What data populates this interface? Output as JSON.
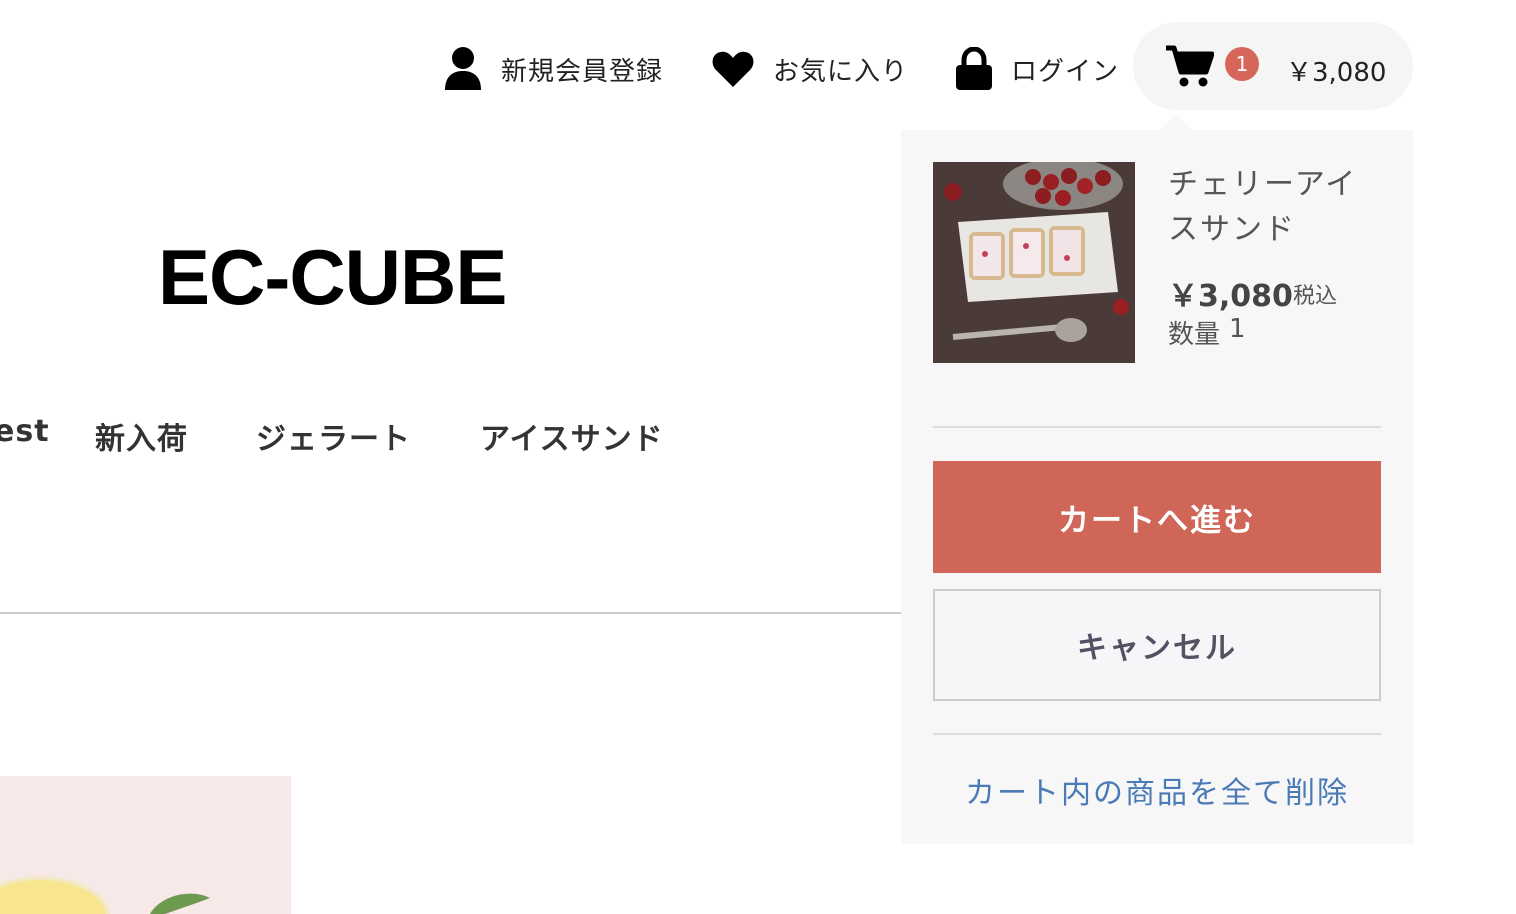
{
  "header": {
    "utility_nav": [
      {
        "label": "新規会員登録",
        "icon": "user-icon"
      },
      {
        "label": "お気に入り",
        "icon": "heart-icon"
      },
      {
        "label": "ログイン",
        "icon": "lock-icon"
      }
    ],
    "cart": {
      "icon": "cart-icon",
      "count": "1",
      "total": "￥3,080"
    }
  },
  "logo": "EC-CUBE",
  "global_nav": [
    "est",
    "新入荷",
    "ジェラート",
    "アイスサンド"
  ],
  "cart_dropdown": {
    "item": {
      "name": "チェリーアイスサンド",
      "price": "￥3,080",
      "tax_label": "税込",
      "quantity_label": "数量",
      "quantity": "1"
    },
    "checkout_button": "カートへ進む",
    "cancel_button": "キャンセル",
    "clear_link": "カート内の商品を全て削除"
  },
  "colors": {
    "accent": "#cf6658",
    "link": "#4a7bb7",
    "dropdown_bg": "#f7f7f7"
  }
}
